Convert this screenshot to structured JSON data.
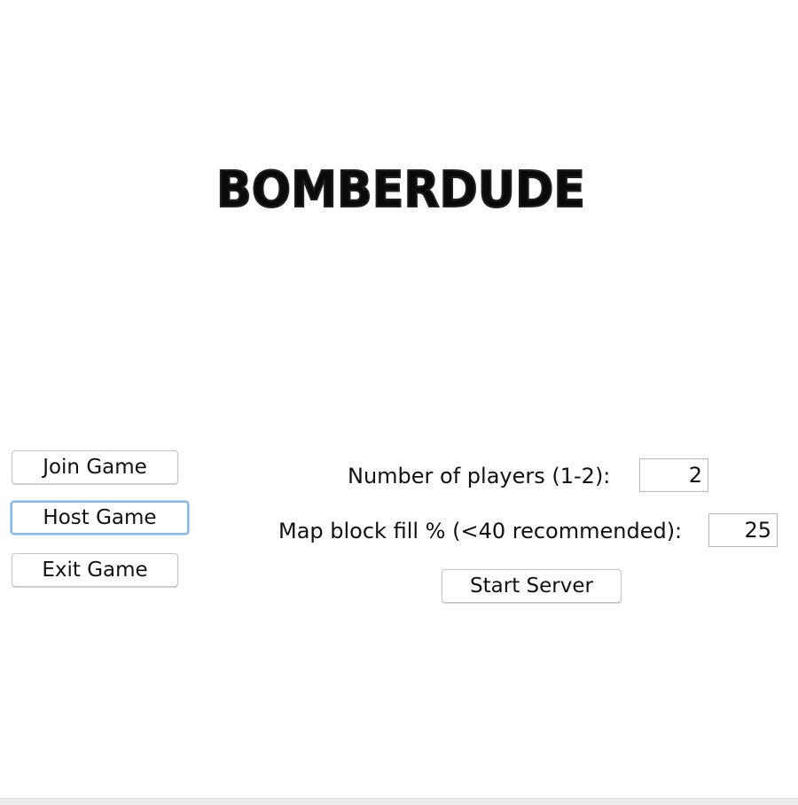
{
  "logo": {
    "text": "BOMBERDUDE"
  },
  "menu": {
    "join_label": "Join Game",
    "host_label": "Host Game",
    "exit_label": "Exit Game"
  },
  "host_panel": {
    "players_label": "Number of players (1-2):",
    "players_value": "2",
    "fill_label": "Map block fill % (<40 recommended):",
    "fill_value": "25",
    "start_label": "Start Server"
  }
}
